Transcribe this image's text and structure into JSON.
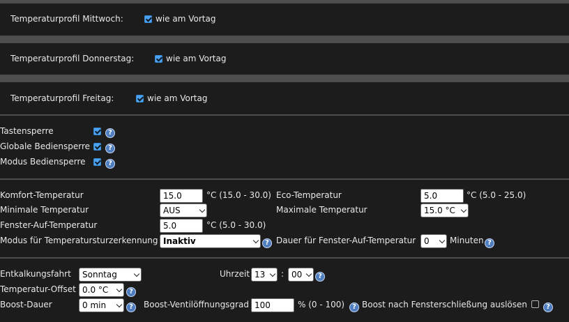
{
  "profiles": [
    {
      "label": "Temperaturprofil Mittwoch:",
      "checkbox_label": "wie am Vortag",
      "checked": true
    },
    {
      "label": "Temperaturprofil Donnerstag:",
      "checkbox_label": "wie am Vortag",
      "checked": true
    },
    {
      "label": "Temperaturprofil Freitag:",
      "checkbox_label": "wie am Vortag",
      "checked": true
    }
  ],
  "locks": {
    "key_lock": {
      "label": "Tastensperre",
      "checked": true
    },
    "global_lock": {
      "label": "Globale Bediensperre",
      "checked": true
    },
    "mode_lock": {
      "label": "Modus Bediensperre",
      "checked": true
    }
  },
  "temps": {
    "comfort": {
      "label": "Komfort-Temperatur",
      "value": "15.0",
      "range": "°C (15.0 - 30.0)"
    },
    "eco": {
      "label": "Eco-Temperatur",
      "value": "5.0",
      "range": "°C (5.0 - 25.0)"
    },
    "min": {
      "label": "Minimale Temperatur",
      "value": "AUS"
    },
    "max": {
      "label": "Maximale Temperatur",
      "value": "15.0 °C"
    },
    "window": {
      "label": "Fenster-Auf-Temperatur",
      "value": "5.0",
      "range": "°C (5.0 - 30.0)"
    },
    "drop_mode": {
      "label": "Modus für Temperatursturzerkennung",
      "value": "Inaktiv"
    },
    "window_duration": {
      "label": "Dauer für Fenster-Auf-Temperatur",
      "value": "0",
      "unit": "Minuten"
    }
  },
  "misc": {
    "decalc": {
      "label": "Entkalkungsfahrt",
      "value": "Sonntag"
    },
    "time": {
      "label": "Uhrzeit",
      "hour": "13",
      "sep": ":",
      "minute": "00"
    },
    "offset": {
      "label": "Temperatur-Offset",
      "value": "0.0 °C"
    },
    "boost_duration": {
      "label": "Boost-Dauer",
      "value": "0 min"
    },
    "boost_valve": {
      "label": "Boost-Ventilöffnungsgrad",
      "value": "100",
      "range": "% (0 - 100)"
    },
    "boost_window": {
      "label": "Boost nach Fensterschließung auslösen",
      "checked": false
    }
  },
  "help_glyph": "?",
  "icons": {
    "help": "help-icon",
    "checkbox": "checkbox-icon",
    "dropdown": "chevron-down-icon"
  },
  "colors": {
    "background": "#1c1c1c",
    "band": "#4d4d4d",
    "checkbox": "#4aa3f0",
    "help": "#4f7ec0",
    "text": "#e8e8e8"
  }
}
